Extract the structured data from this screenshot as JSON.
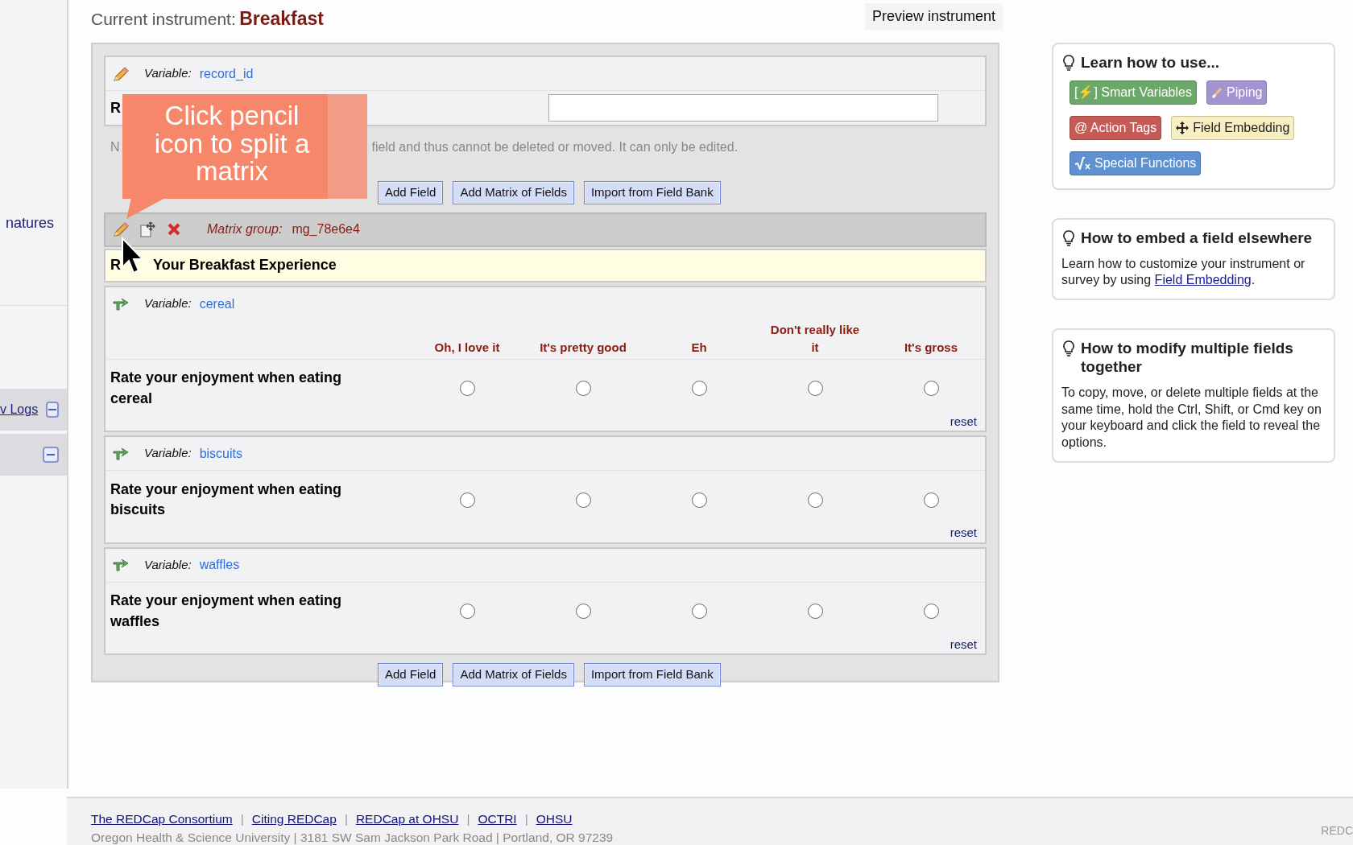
{
  "sidebar": {
    "items": [
      {
        "kind": "link",
        "label": "natures"
      },
      {
        "kind": "band",
        "label": "v Logs"
      },
      {
        "kind": "band"
      }
    ]
  },
  "header": {
    "prefix": "Current instrument:",
    "instrument": "Breakfast",
    "preview_button": "Preview instrument"
  },
  "record_field": {
    "variable_label": "Variable:",
    "variable": "record_id",
    "label": "R",
    "note_start": "N",
    "note_rest": "field and thus cannot be deleted or moved. It can only be edited."
  },
  "add_buttons_top": [
    "Add Field",
    "Add Matrix of Fields",
    "Import from Field Bank"
  ],
  "matrix": {
    "group_label": "Matrix group:",
    "group_name": "mg_78e6e4",
    "header_start": "R",
    "header_rest": "Your Breakfast Experience",
    "columns": [
      "Oh, I love it",
      "It's pretty good",
      "Eh",
      "Don't really like it",
      "It's gross"
    ],
    "fields": [
      {
        "variable_label": "Variable:",
        "variable": "cereal",
        "label": "Rate your enjoyment when eating cereal",
        "choices": [
          {
            "selected": false
          },
          {
            "selected": false
          },
          {
            "selected": false
          },
          {
            "selected": false
          },
          {
            "selected": false
          }
        ],
        "reset": "reset"
      },
      {
        "variable_label": "Variable:",
        "variable": "biscuits",
        "label": "Rate your enjoyment when eating biscuits",
        "choices": [
          {
            "selected": false
          },
          {
            "selected": false
          },
          {
            "selected": false
          },
          {
            "selected": false
          },
          {
            "selected": false
          }
        ],
        "reset": "reset"
      },
      {
        "variable_label": "Variable:",
        "variable": "waffles",
        "label": "Rate your enjoyment when eating waffles",
        "choices": [
          {
            "selected": false
          },
          {
            "selected": false
          },
          {
            "selected": false
          },
          {
            "selected": false
          },
          {
            "selected": false
          }
        ],
        "reset": "reset"
      }
    ]
  },
  "add_buttons_bottom": [
    "Add Field",
    "Add Matrix of Fields",
    "Import from Field Bank"
  ],
  "tooltip": {
    "text": "Click pencil icon to split a matrix"
  },
  "help_cards": [
    {
      "title": "Learn how to use...",
      "badges": [
        {
          "kind": "plain",
          "label": "[⚡] Smart Variables",
          "color": "#6ca86a"
        },
        {
          "kind": "pipe",
          "label": "Piping",
          "color": "#a393d0"
        },
        {
          "kind": "plain",
          "label": "@ Action Tags",
          "color": "#c65b55"
        },
        {
          "kind": "move",
          "label": "Field Embedding",
          "color": "#f8efc2"
        },
        {
          "kind": "sqrt",
          "label": "Special Functions",
          "color": "#5f90cf"
        }
      ]
    },
    {
      "title": "How to embed a field elsewhere",
      "text": "Learn how to customize your instrument or survey by using ",
      "link": "Field Embedding",
      "text_after": "."
    },
    {
      "title": "How to modify multiple fields together",
      "text": "To copy, move, or delete multiple fields at the same time, hold the Ctrl, Shift, or Cmd key on your keyboard and click the field to reveal the options."
    }
  ],
  "footer": {
    "links": [
      {
        "label": "The REDCap Consortium"
      },
      {
        "separator": "|",
        "label": "Citing REDCap"
      },
      {
        "separator": "|",
        "label": "REDCap at OHSU"
      },
      {
        "separator": "|",
        "label": "OCTRI"
      },
      {
        "separator": "|",
        "label": "OHSU"
      }
    ],
    "address": "Oregon Health & Science University | 3181 SW Sam Jackson Park Road | Portland, OR 97239",
    "edge_text": "REDC"
  }
}
